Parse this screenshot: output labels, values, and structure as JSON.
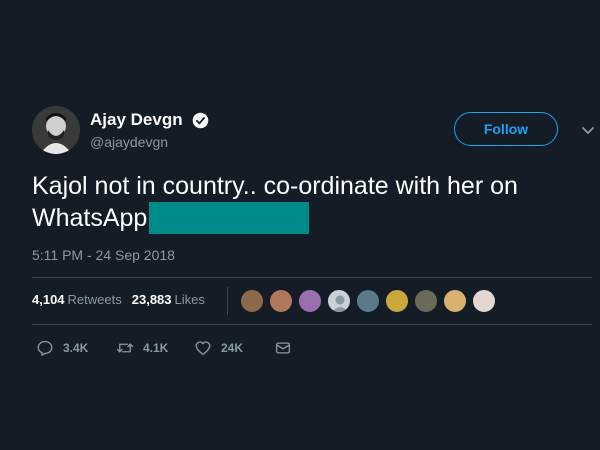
{
  "author": {
    "display_name": "Ajay Devgn",
    "handle": "@ajaydevgn",
    "verified": true,
    "avatar_icon": "profile-photo"
  },
  "follow_label": "Follow",
  "tweet": {
    "text": "Kajol not in country.. co-ordinate with her on WhatsApp",
    "redaction_color": "#008b8b",
    "timestamp": "5:11 PM - 24 Sep 2018"
  },
  "stats": {
    "retweets_count": "4,104",
    "retweets_label": "Retweets",
    "likes_count": "23,883",
    "likes_label": "Likes"
  },
  "liker_avatars": [
    "liker-avatar",
    "liker-avatar",
    "liker-avatar",
    "default-avatar",
    "liker-avatar",
    "liker-avatar",
    "liker-avatar",
    "liker-avatar",
    "liker-avatar"
  ],
  "actions": {
    "reply_count": "3.4K",
    "retweet_count": "4.1K",
    "like_count": "24K"
  },
  "colors": {
    "background": "#141d26",
    "accent": "#1da1f2",
    "muted_text": "#8899a6",
    "divider": "#38444d"
  }
}
